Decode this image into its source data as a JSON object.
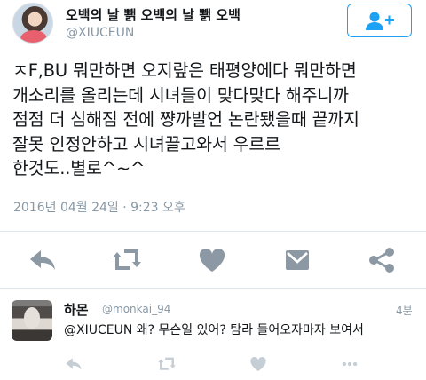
{
  "author": {
    "display_name": "오백의 날 뾁 오백의 날 뾁 오백",
    "handle": "@XIUCEUN"
  },
  "follow_button": {
    "icon": "add-user-icon",
    "color": "#1da1f2"
  },
  "tweet": {
    "lines": [
      "ㅈF,BU 뭐만하면 오지랖은 태평양에다 뭐만하면",
      "개소리를 올리는데 시녀들이 맞다맞다 해주니까",
      "점점 더 심해짐 전에 쨩까발언 논란됐을때 끝까지",
      "잘못 인정안하고 시녀끌고와서 우르르",
      "한것도..별로^~^"
    ],
    "timestamp": "2016년 04월 24일 · 9:23 오후"
  },
  "actions": [
    "reply-icon",
    "retweet-icon",
    "like-icon",
    "message-icon",
    "share-icon"
  ],
  "reply": {
    "name": "하몬",
    "handle": "@monkai_94",
    "time": "4분",
    "text": "@XIUCEUN 왜? 무슨일 있어? 탐라 들어오자마자 보여서"
  },
  "colors": {
    "icon_gray": "#8c98a3",
    "secondary_text": "#8899a6",
    "accent": "#1da1f2"
  }
}
